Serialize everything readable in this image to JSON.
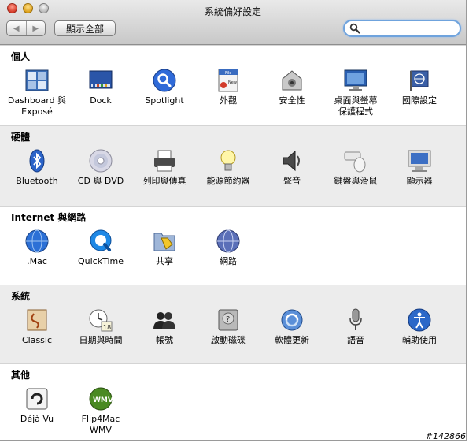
{
  "window": {
    "title": "系統偏好設定"
  },
  "toolbar": {
    "back_icon": "◀",
    "forward_icon": "▶",
    "show_all_label": "顯示全部",
    "search_value": "",
    "search_placeholder": ""
  },
  "sections": [
    {
      "title": "個人",
      "items": [
        {
          "label": "Dashboard 與\nExposé",
          "icon": "dashboard-expose-icon"
        },
        {
          "label": "Dock",
          "icon": "dock-icon"
        },
        {
          "label": "Spotlight",
          "icon": "spotlight-icon"
        },
        {
          "label": "外觀",
          "icon": "appearance-icon"
        },
        {
          "label": "安全性",
          "icon": "security-icon"
        },
        {
          "label": "桌面與螢幕\n保護程式",
          "icon": "desktop-screensaver-icon"
        },
        {
          "label": "國際設定",
          "icon": "international-icon"
        }
      ]
    },
    {
      "title": "硬體",
      "items": [
        {
          "label": "Bluetooth",
          "icon": "bluetooth-icon"
        },
        {
          "label": "CD 與 DVD",
          "icon": "cd-dvd-icon"
        },
        {
          "label": "列印與傳真",
          "icon": "printer-icon"
        },
        {
          "label": "能源節約器",
          "icon": "energy-saver-icon"
        },
        {
          "label": "聲音",
          "icon": "sound-icon"
        },
        {
          "label": "鍵盤與滑鼠",
          "icon": "keyboard-mouse-icon"
        },
        {
          "label": "顯示器",
          "icon": "displays-icon"
        }
      ]
    },
    {
      "title": "Internet 與網路",
      "items": [
        {
          "label": ".Mac",
          "icon": "dotmac-icon"
        },
        {
          "label": "QuickTime",
          "icon": "quicktime-icon"
        },
        {
          "label": "共享",
          "icon": "sharing-icon"
        },
        {
          "label": "網路",
          "icon": "network-icon"
        }
      ]
    },
    {
      "title": "系統",
      "items": [
        {
          "label": "Classic",
          "icon": "classic-icon"
        },
        {
          "label": "日期與時間",
          "icon": "date-time-icon"
        },
        {
          "label": "帳號",
          "icon": "accounts-icon"
        },
        {
          "label": "啟動磁碟",
          "icon": "startup-disk-icon"
        },
        {
          "label": "軟體更新",
          "icon": "software-update-icon"
        },
        {
          "label": "語音",
          "icon": "speech-icon"
        },
        {
          "label": "輔助使用",
          "icon": "universal-access-icon"
        }
      ]
    },
    {
      "title": "其他",
      "items": [
        {
          "label": "Déjà Vu",
          "icon": "deja-vu-icon"
        },
        {
          "label": "Flip4Mac\nWMV",
          "icon": "flip4mac-icon"
        }
      ]
    }
  ],
  "watermark": "#142866"
}
